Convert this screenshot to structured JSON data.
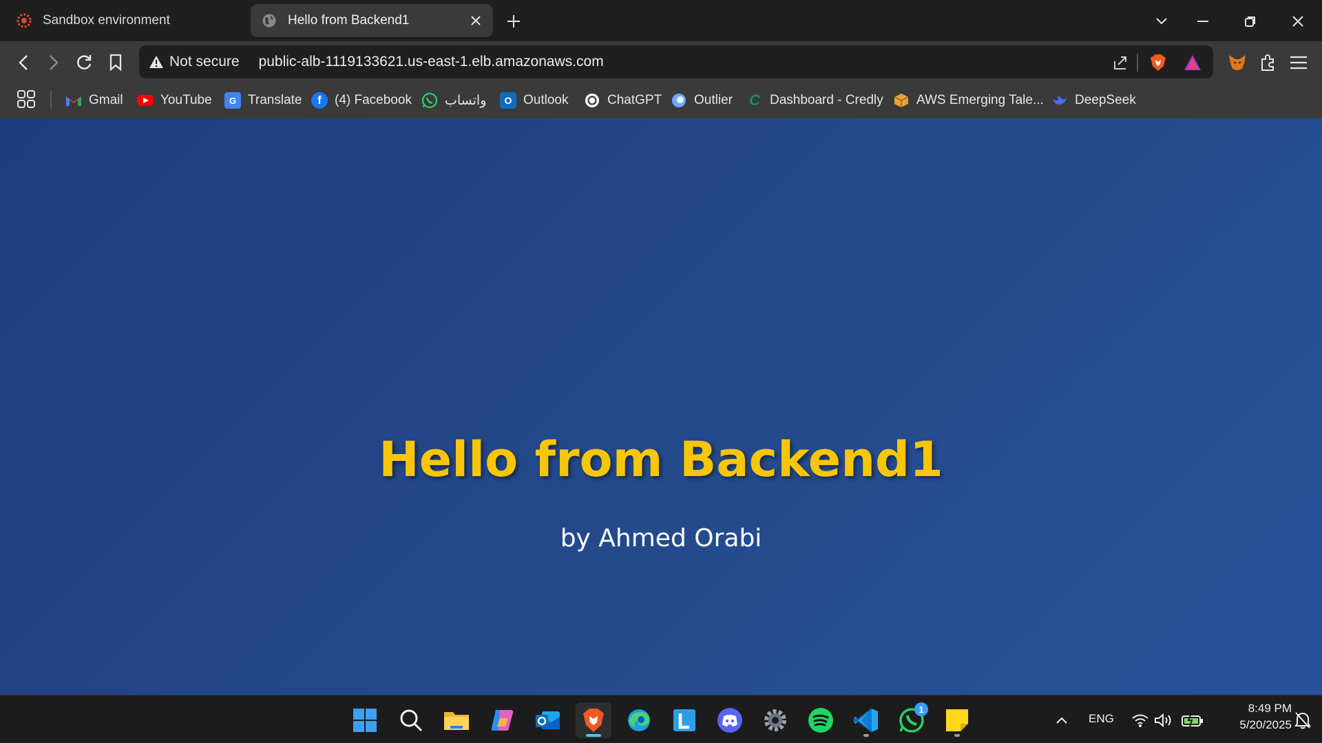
{
  "tabs": [
    {
      "title": "Sandbox environment",
      "active": false,
      "icon": "cog-red-icon"
    },
    {
      "title": "Hello from Backend1",
      "active": true,
      "icon": "globe-icon"
    }
  ],
  "toolbar": {
    "security_label": "Not secure",
    "url": "public-alb-1119133621.us-east-1.elb.amazonaws.com"
  },
  "bookmarks": [
    {
      "label": "Gmail",
      "icon": "gmail-icon",
      "color": "#ea4335"
    },
    {
      "label": "YouTube",
      "icon": "youtube-icon",
      "color": "#ff0000"
    },
    {
      "label": "Translate",
      "icon": "translate-icon",
      "color": "#4285f4"
    },
    {
      "label": "(4) Facebook",
      "icon": "facebook-icon",
      "color": "#1877f2"
    },
    {
      "label": "واتساب",
      "icon": "whatsapp-icon",
      "color": "#25d366"
    },
    {
      "label": "Outlook",
      "icon": "outlook-icon",
      "color": "#0f6cbd"
    },
    {
      "label": "ChatGPT",
      "icon": "chatgpt-icon",
      "color": "#ffffff"
    },
    {
      "label": "Outlier",
      "icon": "outlier-icon",
      "color": "#6aa9ff"
    },
    {
      "label": "Dashboard - Credly",
      "icon": "credly-icon",
      "color": "#1b8a72"
    },
    {
      "label": "AWS Emerging Tale...",
      "icon": "aws-box-icon",
      "color": "#e8a33d"
    },
    {
      "label": "DeepSeek",
      "icon": "deepseek-icon",
      "color": "#4d6bfe"
    }
  ],
  "page": {
    "heading": "Hello from Backend1",
    "byline": "by Ahmed Orabi"
  },
  "taskbar": {
    "apps": [
      "windows-start-icon",
      "search-icon",
      "file-explorer-icon",
      "copilot-icon",
      "outlook-app-icon",
      "brave-icon",
      "edge-icon",
      "launcher-l-icon",
      "discord-icon",
      "settings-icon",
      "spotify-icon",
      "vscode-icon",
      "whatsapp-app-icon",
      "sticky-notes-icon"
    ],
    "whatsapp_badge": "1",
    "language": "ENG",
    "time": "8:49 PM",
    "date": "5/20/2025"
  },
  "colors": {
    "heading": "#f7c608",
    "background": "#234689"
  }
}
